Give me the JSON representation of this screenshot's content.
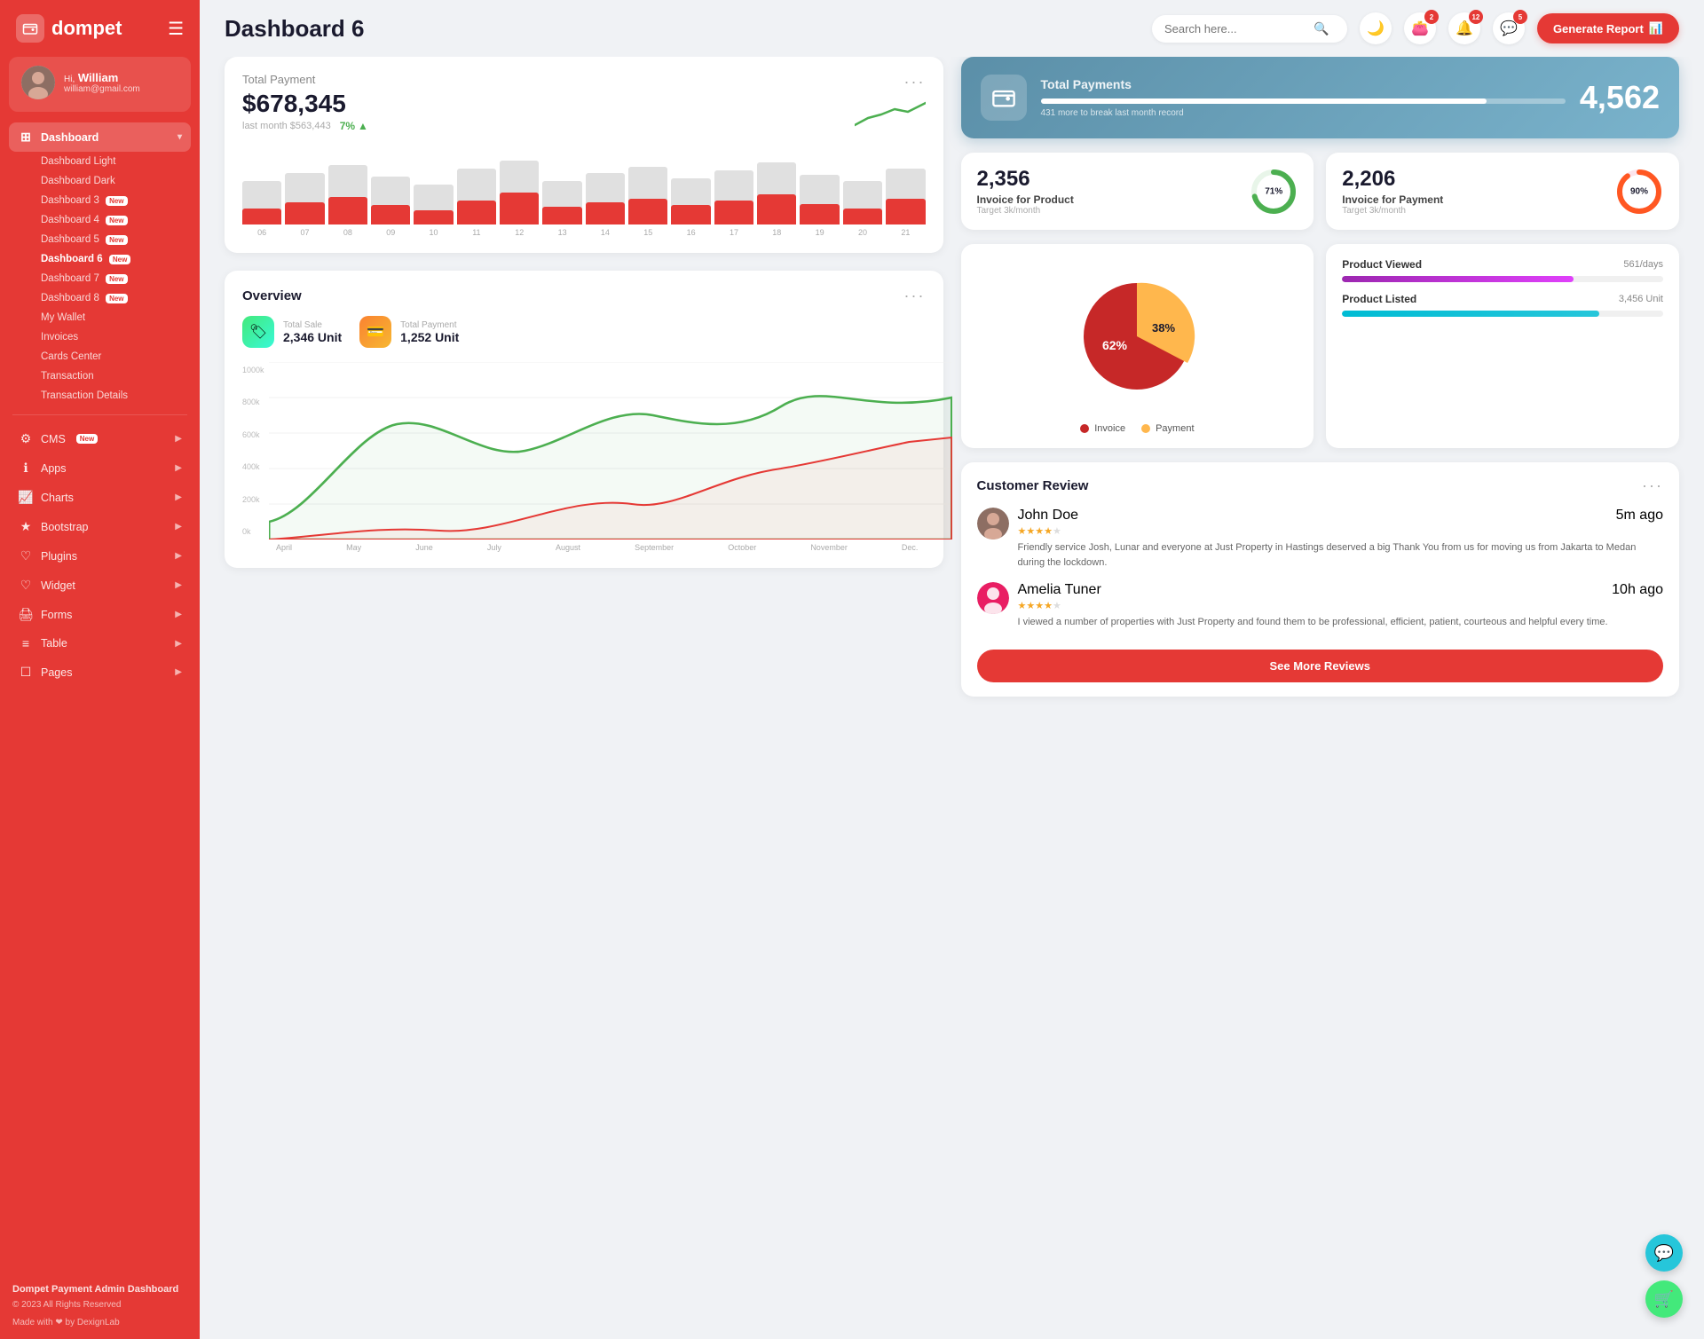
{
  "brand": {
    "logo_text": "dompet",
    "logo_icon": "👛"
  },
  "user": {
    "greeting": "Hi,",
    "name": "William",
    "email": "william@gmail.com"
  },
  "sidebar": {
    "dashboard_label": "Dashboard",
    "items": [
      {
        "label": "Dashboard Light",
        "id": "dashboard-light"
      },
      {
        "label": "Dashboard Dark",
        "id": "dashboard-dark"
      },
      {
        "label": "Dashboard 3",
        "id": "dashboard-3",
        "badge": "New"
      },
      {
        "label": "Dashboard 4",
        "id": "dashboard-4",
        "badge": "New"
      },
      {
        "label": "Dashboard 5",
        "id": "dashboard-5",
        "badge": "New"
      },
      {
        "label": "Dashboard 6",
        "id": "dashboard-6",
        "badge": "New",
        "active": true
      },
      {
        "label": "Dashboard 7",
        "id": "dashboard-7",
        "badge": "New"
      },
      {
        "label": "Dashboard 8",
        "id": "dashboard-8",
        "badge": "New"
      },
      {
        "label": "My Wallet",
        "id": "my-wallet"
      },
      {
        "label": "Invoices",
        "id": "invoices"
      },
      {
        "label": "Cards Center",
        "id": "cards-center"
      },
      {
        "label": "Transaction",
        "id": "transaction"
      },
      {
        "label": "Transaction Details",
        "id": "transaction-details"
      }
    ],
    "nav_items": [
      {
        "label": "CMS",
        "badge": "New",
        "has_arrow": true
      },
      {
        "label": "Apps",
        "has_arrow": true
      },
      {
        "label": "Charts",
        "has_arrow": true
      },
      {
        "label": "Bootstrap",
        "has_arrow": true
      },
      {
        "label": "Plugins",
        "has_arrow": true
      },
      {
        "label": "Widget",
        "has_arrow": true
      },
      {
        "label": "Forms",
        "has_arrow": true
      },
      {
        "label": "Table",
        "has_arrow": true
      },
      {
        "label": "Pages",
        "has_arrow": true
      }
    ],
    "footer_title": "Dompet Payment Admin Dashboard",
    "footer_copy": "© 2023 All Rights Reserved",
    "made_with": "Made with ❤ by DexignLab"
  },
  "topbar": {
    "page_title": "Dashboard 6",
    "search_placeholder": "Search here...",
    "badges": {
      "wallet": "2",
      "bell": "12",
      "chat": "5"
    },
    "generate_btn": "Generate Report"
  },
  "total_payment": {
    "label": "Total Payment",
    "amount": "$678,345",
    "last_month": "last month $563,443",
    "trend_pct": "7%",
    "bars": [
      {
        "tall": 55,
        "short": 20,
        "label": "06"
      },
      {
        "tall": 65,
        "short": 28,
        "label": "07"
      },
      {
        "tall": 75,
        "short": 35,
        "label": "08"
      },
      {
        "tall": 60,
        "short": 25,
        "label": "09"
      },
      {
        "tall": 50,
        "short": 18,
        "label": "10"
      },
      {
        "tall": 70,
        "short": 30,
        "label": "11"
      },
      {
        "tall": 80,
        "short": 40,
        "label": "12"
      },
      {
        "tall": 55,
        "short": 22,
        "label": "13"
      },
      {
        "tall": 65,
        "short": 28,
        "label": "14"
      },
      {
        "tall": 72,
        "short": 32,
        "label": "15"
      },
      {
        "tall": 58,
        "short": 24,
        "label": "16"
      },
      {
        "tall": 68,
        "short": 30,
        "label": "17"
      },
      {
        "tall": 78,
        "short": 38,
        "label": "18"
      },
      {
        "tall": 62,
        "short": 26,
        "label": "19"
      },
      {
        "tall": 55,
        "short": 20,
        "label": "20"
      },
      {
        "tall": 70,
        "short": 32,
        "label": "21"
      }
    ]
  },
  "total_payments_hero": {
    "title": "Total Payments",
    "sub": "431 more to break last month record",
    "value": "4,562",
    "progress_pct": 85
  },
  "invoice_product": {
    "value": "2,356",
    "label": "Invoice for Product",
    "target": "Target 3k/month",
    "pct": 71,
    "color": "#4caf50"
  },
  "invoice_payment": {
    "value": "2,206",
    "label": "Invoice for Payment",
    "target": "Target 3k/month",
    "pct": 90,
    "color": "#ff5722"
  },
  "overview": {
    "title": "Overview",
    "total_sale_label": "Total Sale",
    "total_sale_value": "2,346 Unit",
    "total_payment_label": "Total Payment",
    "total_payment_value": "1,252 Unit",
    "x_labels": [
      "April",
      "May",
      "June",
      "July",
      "August",
      "September",
      "October",
      "November",
      "Dec."
    ],
    "y_labels": [
      "1000k",
      "800k",
      "600k",
      "400k",
      "200k",
      "0k"
    ]
  },
  "pie_chart": {
    "invoice_pct": 62,
    "payment_pct": 38,
    "invoice_label": "Invoice",
    "payment_label": "Payment",
    "invoice_color": "#c62828",
    "payment_color": "#ffb74d"
  },
  "product_stats": {
    "items": [
      {
        "name": "Product Viewed",
        "value": "561/days",
        "pct": 72,
        "color": "purple"
      },
      {
        "name": "Product Listed",
        "value": "3,456 Unit",
        "pct": 80,
        "color": "teal"
      }
    ]
  },
  "customer_review": {
    "title": "Customer Review",
    "reviews": [
      {
        "name": "John Doe",
        "time": "5m ago",
        "stars": 4,
        "text": "Friendly service Josh, Lunar and everyone at Just Property in Hastings deserved a big Thank You from us for moving us from Jakarta to Medan during the lockdown."
      },
      {
        "name": "Amelia Tuner",
        "time": "10h ago",
        "stars": 4,
        "text": "I viewed a number of properties with Just Property and found them to be professional, efficient, patient, courteous and helpful every time."
      }
    ],
    "see_more_btn": "See More Reviews"
  },
  "colors": {
    "primary": "#e53935",
    "sidebar_bg": "#e53935"
  }
}
